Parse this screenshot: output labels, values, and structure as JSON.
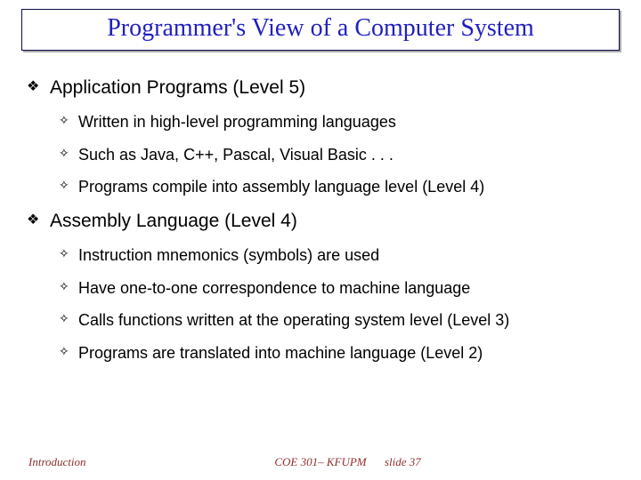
{
  "title": "Programmer's View of a Computer System",
  "sections": [
    {
      "heading": "Application Programs (Level 5)",
      "items": [
        "Written in high-level programming languages",
        "Such as Java, C++, Pascal, Visual Basic . . .",
        "Programs compile into assembly language level (Level 4)"
      ]
    },
    {
      "heading": " Assembly Language (Level 4)",
      "items": [
        "Instruction mnemonics (symbols) are used",
        "Have one-to-one correspondence to machine language",
        "Calls functions written at the operating system level (Level 3)",
        "Programs are translated into machine language (Level 2)"
      ]
    }
  ],
  "footer": {
    "left": "Introduction",
    "center": "COE 301– KFUPM",
    "right": "slide 37"
  },
  "bullets": {
    "l1": "❖",
    "l2": "✧"
  }
}
